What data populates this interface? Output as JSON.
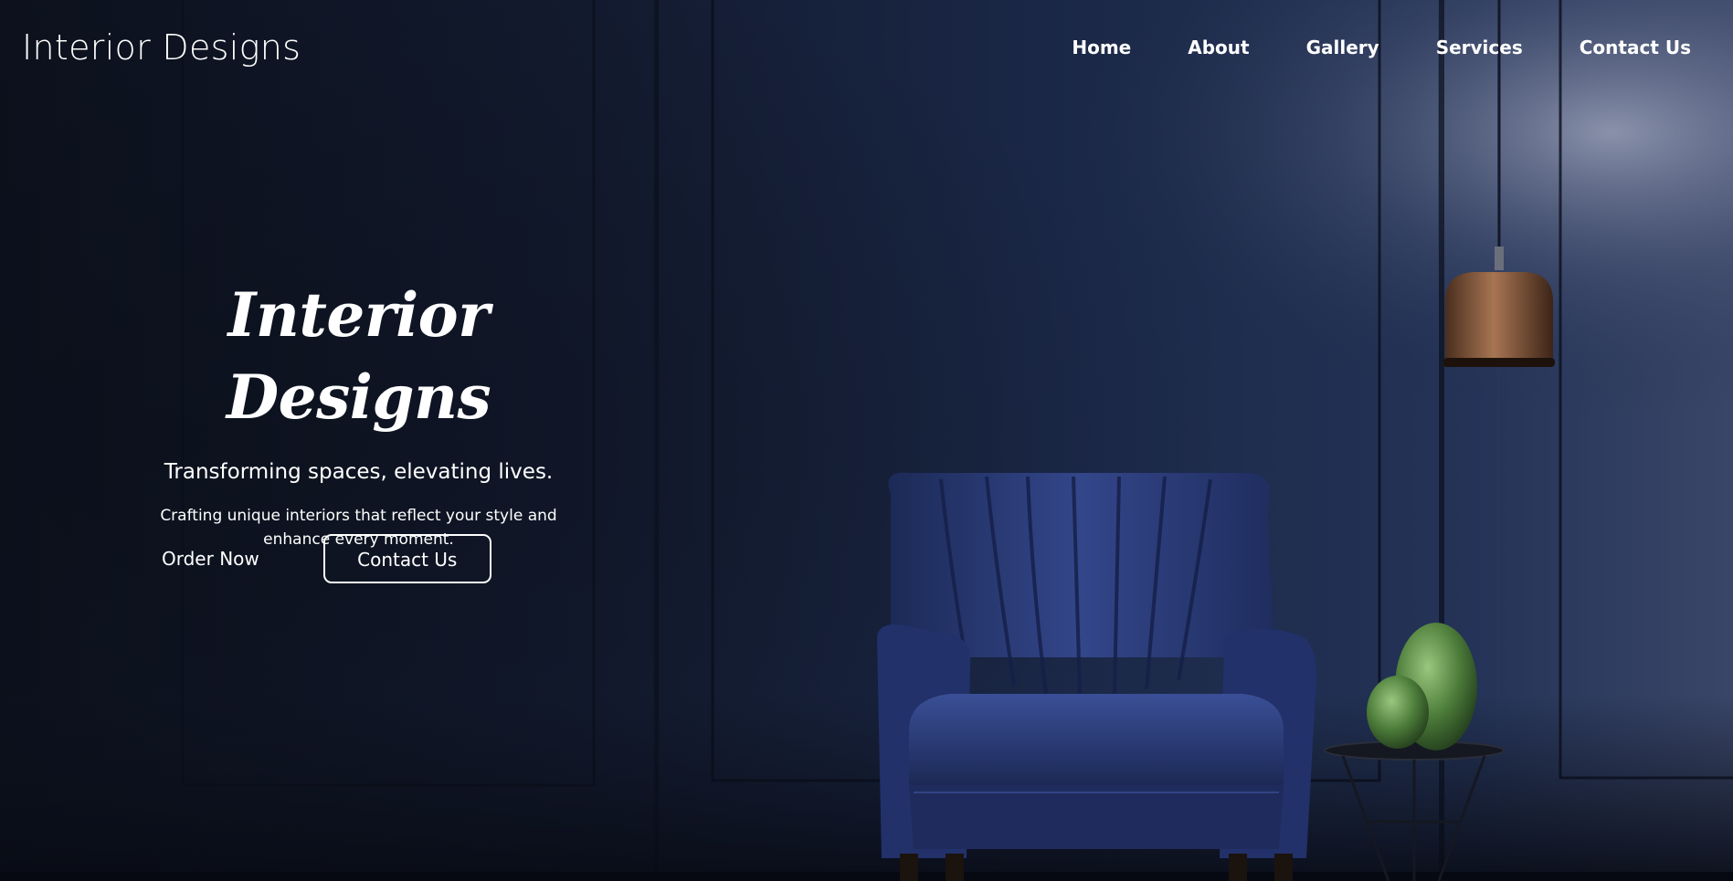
{
  "header": {
    "logo": "Interior Designs",
    "nav": [
      {
        "label": "Home"
      },
      {
        "label": "About"
      },
      {
        "label": "Gallery"
      },
      {
        "label": "Services"
      },
      {
        "label": "Contact Us"
      }
    ]
  },
  "hero": {
    "title": "Interior Designs",
    "tagline": "Transforming spaces, elevating lives.",
    "description": "Crafting unique interiors that reflect your style and enhance every moment.",
    "primary_cta": "Order Now",
    "secondary_cta": "Contact Us"
  },
  "colors": {
    "background": "#0e1424",
    "wall": "#1a2748",
    "armchair": "#2c3f7a",
    "lamp": "#8a5a3c",
    "vase": "#5a8a45",
    "text": "#ffffff"
  }
}
